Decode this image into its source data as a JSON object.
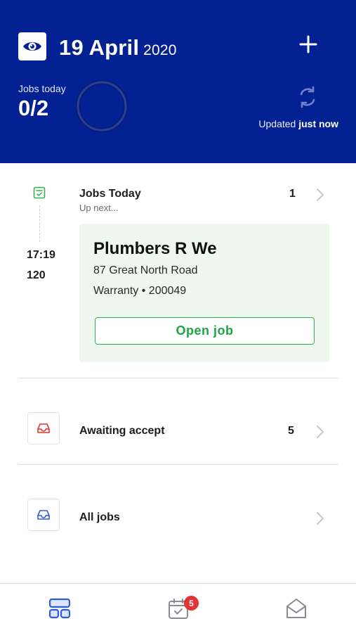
{
  "header": {
    "date_day": "19 April",
    "date_year": "2020",
    "jobs_today_label": "Jobs today",
    "jobs_today_count": "0/2",
    "jobs_today_progress": 0,
    "updated_prefix": "Updated",
    "updated_value": "just now"
  },
  "jobs_today": {
    "title": "Jobs Today",
    "subtitle": "Up next...",
    "count": "1",
    "next_job": {
      "time": "17:19",
      "duration": "120",
      "name": "Plumbers R We",
      "address": "87 Great North Road",
      "meta": "Warranty • 200049",
      "open_label": "Open job"
    }
  },
  "awaiting": {
    "label": "Awaiting accept",
    "count": "5"
  },
  "all_jobs": {
    "label": "All jobs"
  },
  "bottom_nav": {
    "calendar_badge": "5"
  },
  "colors": {
    "header_bg": "#032193",
    "accent_green": "#2bb34e",
    "badge_red": "#e23434",
    "nav_blue": "#2f5bd6"
  }
}
